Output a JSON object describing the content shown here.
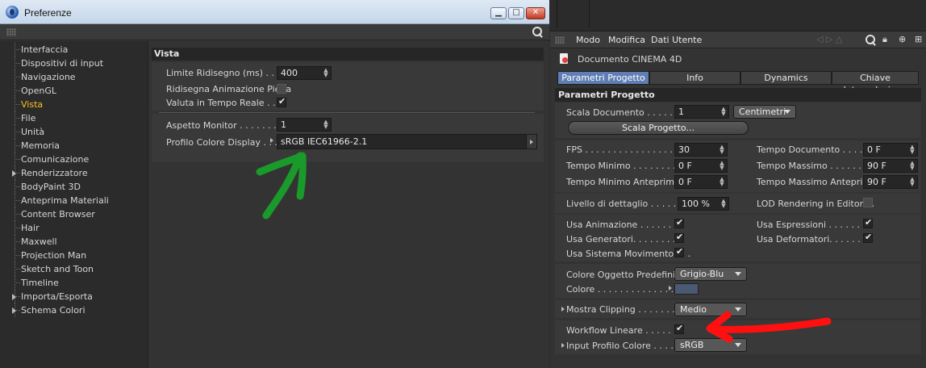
{
  "window": {
    "title": "Preferenze",
    "controls": {
      "minimize": "▁",
      "maximize": "□",
      "close": "✕"
    }
  },
  "sidebar": {
    "items": [
      {
        "label": "Interfaccia"
      },
      {
        "label": "Dispositivi di input"
      },
      {
        "label": "Navigazione"
      },
      {
        "label": "OpenGL"
      },
      {
        "label": "Vista",
        "active": true
      },
      {
        "label": "File"
      },
      {
        "label": "Unità"
      },
      {
        "label": "Memoria"
      },
      {
        "label": "Comunicazione"
      },
      {
        "label": "Renderizzatore",
        "expandable": true
      },
      {
        "label": "BodyPaint 3D"
      },
      {
        "label": "Anteprima Materiali"
      },
      {
        "label": "Content Browser"
      },
      {
        "label": "Hair"
      },
      {
        "label": "Maxwell"
      },
      {
        "label": "Projection Man"
      },
      {
        "label": "Sketch and Toon"
      },
      {
        "label": "Timeline"
      },
      {
        "label": "Importa/Esporta",
        "expandable": true
      },
      {
        "label": "Schema Colori",
        "expandable": true
      }
    ]
  },
  "vista": {
    "header": "Vista",
    "limite_label": "Limite Ridisegno (ms) . . . . .",
    "limite_value": "400",
    "ridisegna_label": "Ridisegna Animazione Piena",
    "valuta_label": "Valuta in Tempo Reale . . . .",
    "aspetto_label": "Aspetto Monitor . . . . . . . . .",
    "aspetto_value": "1",
    "profilo_label": "Profilo Colore Display . . .",
    "profilo_value": "sRGB IEC61966-2.1"
  },
  "attr": {
    "menu": {
      "modo": "Modo",
      "modifica": "Modifica",
      "dati_utente": "Dati Utente"
    },
    "document_title": "Documento CINEMA 4D",
    "tabs": [
      {
        "label": "Parametri Progetto",
        "active": true
      },
      {
        "label": "Info"
      },
      {
        "label": "Dynamics"
      },
      {
        "label": "Chiave Interpolazione"
      }
    ],
    "section_title": "Parametri Progetto",
    "scala_label": "Scala Documento . . . . . . . .",
    "scala_value": "1",
    "scala_unit": "Centimetri",
    "scala_button": "Scala Progetto...",
    "fps_label": "FPS . . . . . . . . . . . . . . . . . .",
    "fps_value": "30",
    "tempo_doc_label": "Tempo Documento . . . . . .",
    "tempo_doc_value": "0 F",
    "tempo_min_label": "Tempo Minimo . . . . . . . . .",
    "tempo_min_value": "0 F",
    "tempo_max_label": "Tempo Massimo . . . . . . . .",
    "tempo_max_value": "90 F",
    "tempo_min_ant_label": "Tempo Minimo Anteprima",
    "tempo_min_ant_value": "0 F",
    "tempo_max_ant_label": "Tempo Massimo Anteprima",
    "tempo_max_ant_value": "90 F",
    "livello_label": "Livello di dettaglio . . . . . .",
    "livello_value": "100 %",
    "lod_label": "LOD Rendering in Editor . .",
    "usa_anim_label": "Usa Animazione . . . . . . . .",
    "usa_espr_label": "Usa Espressioni . . . . . . . .",
    "usa_gen_label": "Usa Generatori. . . . . . . . .",
    "usa_def_label": "Usa Deformatori. . . . . . . .",
    "usa_sist_label": "Usa Sistema Movimento . . .",
    "colore_ogg_label": "Colore Oggetto Predefinito",
    "colore_ogg_value": "Grigio-Blu",
    "colore_label": "Colore . . . . . . . . . . . . . .",
    "mostra_label": "Mostra Clipping . . . . . . . .",
    "mostra_value": "Medio",
    "workflow_label": "Workflow Lineare . . . . . . .",
    "input_profilo_label": "Input Profilo Colore . . . . .",
    "input_profilo_value": "sRGB"
  },
  "colors": {
    "accent_active_tab": "#607eb4",
    "active_tree_item": "#ffc020",
    "green_arrow": "#1a9a2a",
    "red_arrow": "#ff1010"
  }
}
